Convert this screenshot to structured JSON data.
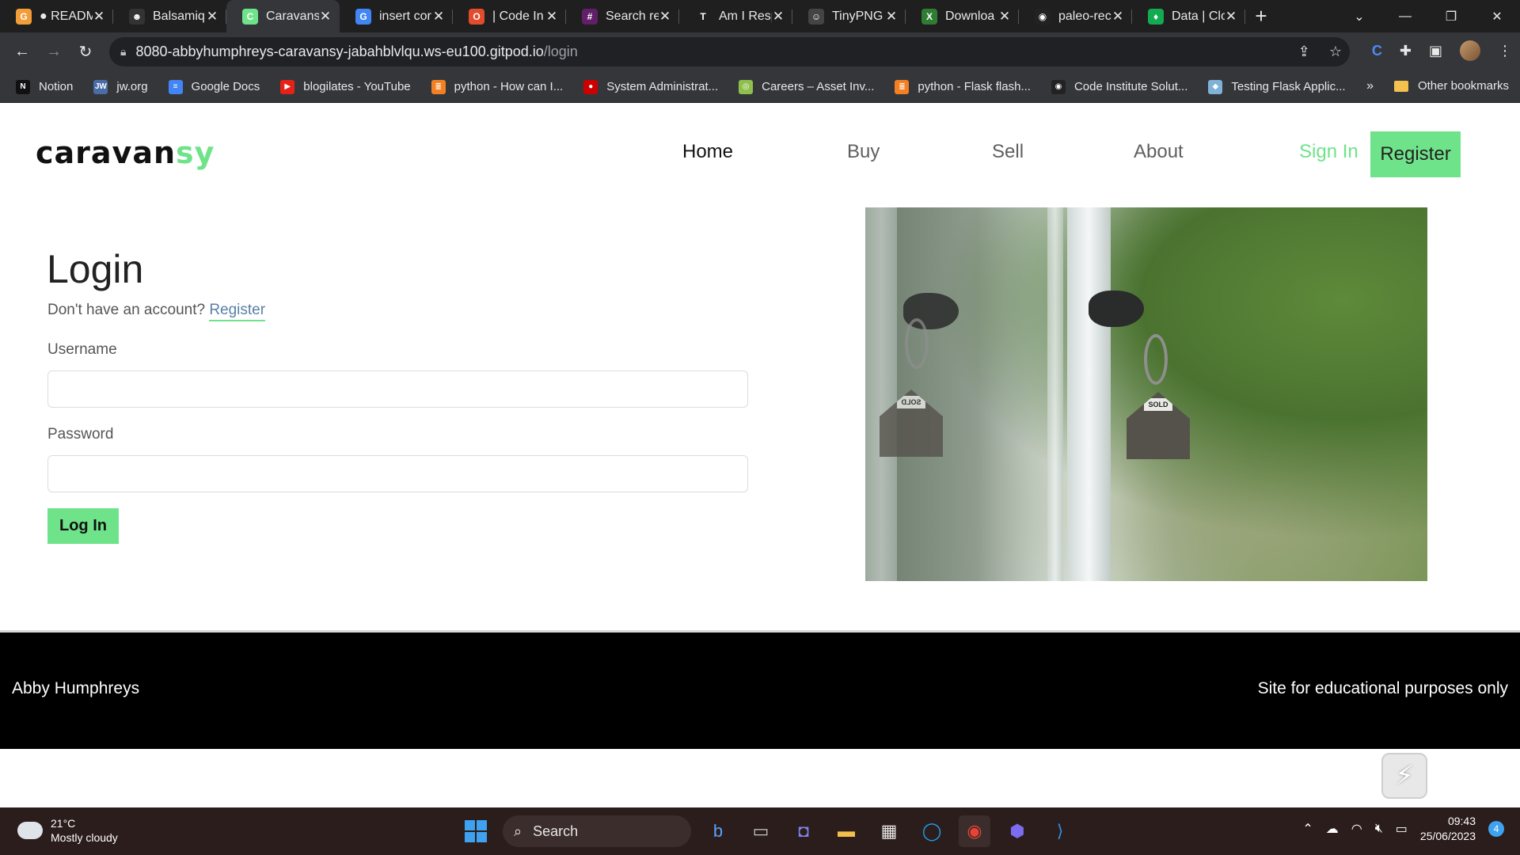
{
  "browser": {
    "tabs": [
      {
        "title": "● READM",
        "color": "#f29d38",
        "glyph": "G"
      },
      {
        "title": "Balsamiq",
        "color": "#333333",
        "glyph": "☻"
      },
      {
        "title": "Caravans",
        "color": "#6fe38a",
        "glyph": "C"
      },
      {
        "title": "insert cor",
        "color": "#4285f4",
        "glyph": "G"
      },
      {
        "title": "| Code In",
        "color": "#e34b2d",
        "glyph": "O"
      },
      {
        "title": "Search re",
        "color": "#611f69",
        "glyph": "#"
      },
      {
        "title": "Am I Resp",
        "color": "#1f1f1f",
        "glyph": "T"
      },
      {
        "title": "TinyPNG",
        "color": "#444444",
        "glyph": "☺"
      },
      {
        "title": "Downloa",
        "color": "#2e7d32",
        "glyph": "X"
      },
      {
        "title": "paleo-rec",
        "color": "#222222",
        "glyph": "◉"
      },
      {
        "title": "Data | Clc",
        "color": "#13aa52",
        "glyph": "♦"
      }
    ],
    "url_host": "8080-abbyhumphreys-caravansy-jabahblvlqu.ws-eu100.gitpod.io",
    "url_path": "/login",
    "bookmarks": [
      {
        "label": "Notion",
        "color": "#111111",
        "glyph": "N"
      },
      {
        "label": "jw.org",
        "color": "#4a6da7",
        "glyph": "JW"
      },
      {
        "label": "Google Docs",
        "color": "#4285f4",
        "glyph": "≡"
      },
      {
        "label": "blogilates - YouTube",
        "color": "#e62117",
        "glyph": "▶"
      },
      {
        "label": "python - How can I...",
        "color": "#f48024",
        "glyph": "≣"
      },
      {
        "label": "System Administrat...",
        "color": "#cc0000",
        "glyph": "●"
      },
      {
        "label": "Careers – Asset Inv...",
        "color": "#8fbf4d",
        "glyph": "◎"
      },
      {
        "label": "python - Flask flash...",
        "color": "#f48024",
        "glyph": "≣"
      },
      {
        "label": "Code Institute Solut...",
        "color": "#222222",
        "glyph": "◉"
      },
      {
        "label": "Testing Flask Applic...",
        "color": "#7fb2d8",
        "glyph": "◆"
      }
    ],
    "bookmarks_more": "»",
    "other_bookmarks": "Other bookmarks"
  },
  "site": {
    "brand_a": "caravan",
    "brand_b": "sy",
    "nav": {
      "home": "Home",
      "buy": "Buy",
      "sell": "Sell",
      "about": "About",
      "sign_in": "Sign In",
      "register": "Register"
    },
    "login": {
      "title": "Login",
      "hint": "Don't have an account?",
      "hint_link": "Register",
      "username_label": "Username",
      "username_value": "",
      "password_label": "Password",
      "password_value": "",
      "submit": "Log In"
    },
    "photo": {
      "tag_left": "SOLD",
      "tag_right": "SOLD"
    },
    "footer": {
      "left": "Abby Humphreys",
      "right": "Site for educational purposes only"
    }
  },
  "taskbar": {
    "temp": "21°C",
    "weather": "Mostly cloudy",
    "search": "Search",
    "time": "09:43",
    "date": "25/06/2023",
    "notifications": "4"
  },
  "colors": {
    "accent_green": "#6fe38a",
    "footer_bg": "#000000"
  }
}
